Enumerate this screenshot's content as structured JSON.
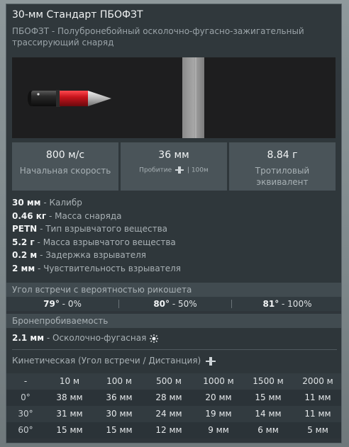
{
  "title": "30-мм Стандарт ПБОФЗТ",
  "subtitle": "ПБОФЗТ - Полубронебойный осколочно-фугасно-зажигательный трассирующий снаряд",
  "stats": [
    {
      "value": "800 м/с",
      "label": "Начальная скорость"
    },
    {
      "value": "36 мм",
      "label_prefix": "Пробитие",
      "label_suffix": "| 100м",
      "icon": "penetration-icon"
    },
    {
      "value": "8.84 г",
      "label": "Тротиловый эквивалент"
    }
  ],
  "properties": [
    {
      "value": "30 мм",
      "label": "- Калибр"
    },
    {
      "value": "0.46 кг",
      "label": "- Масса снаряда"
    },
    {
      "value": "PETN",
      "label": "- Тип взрывчатого вещества"
    },
    {
      "value": "5.2 г",
      "label": "- Масса взрывчатого вещества"
    },
    {
      "value": "0.2 м",
      "label": "- Задержка взрывателя"
    },
    {
      "value": "2 мм",
      "label": "- Чувствительность взрывателя"
    }
  ],
  "ricochet": {
    "header": "Угол встречи с вероятностью рикошета",
    "items": [
      {
        "angle": "79°",
        "prob": "- 0%"
      },
      {
        "angle": "80°",
        "prob": "- 50%"
      },
      {
        "angle": "81°",
        "prob": "- 100%"
      }
    ]
  },
  "armor": {
    "header": "Бронепробиваемость",
    "he_value": "2.1 мм",
    "he_label": "- Осколочно-фугасная",
    "he_icon": "explosion-icon",
    "kinetic_header": "Кинетическая (Угол встречи / Дистанция)",
    "kinetic_icon": "penetration-icon"
  },
  "penetration_table": {
    "columns": [
      "-",
      "10 м",
      "100 м",
      "500 м",
      "1000 м",
      "1500 м",
      "2000 м"
    ],
    "rows": [
      [
        "0°",
        "38 мм",
        "36 мм",
        "28 мм",
        "20 мм",
        "15 мм",
        "11 мм"
      ],
      [
        "30°",
        "31 мм",
        "30 мм",
        "24 мм",
        "19 мм",
        "14 мм",
        "11 мм"
      ],
      [
        "60°",
        "15 мм",
        "15 мм",
        "12 мм",
        "9 мм",
        "6 мм",
        "5 мм"
      ]
    ]
  },
  "colors": {
    "panel_bg": "#293035",
    "tracer_red": "#c8141c",
    "text_primary": "#f2f4f5",
    "text_secondary": "#a9b1b5"
  }
}
